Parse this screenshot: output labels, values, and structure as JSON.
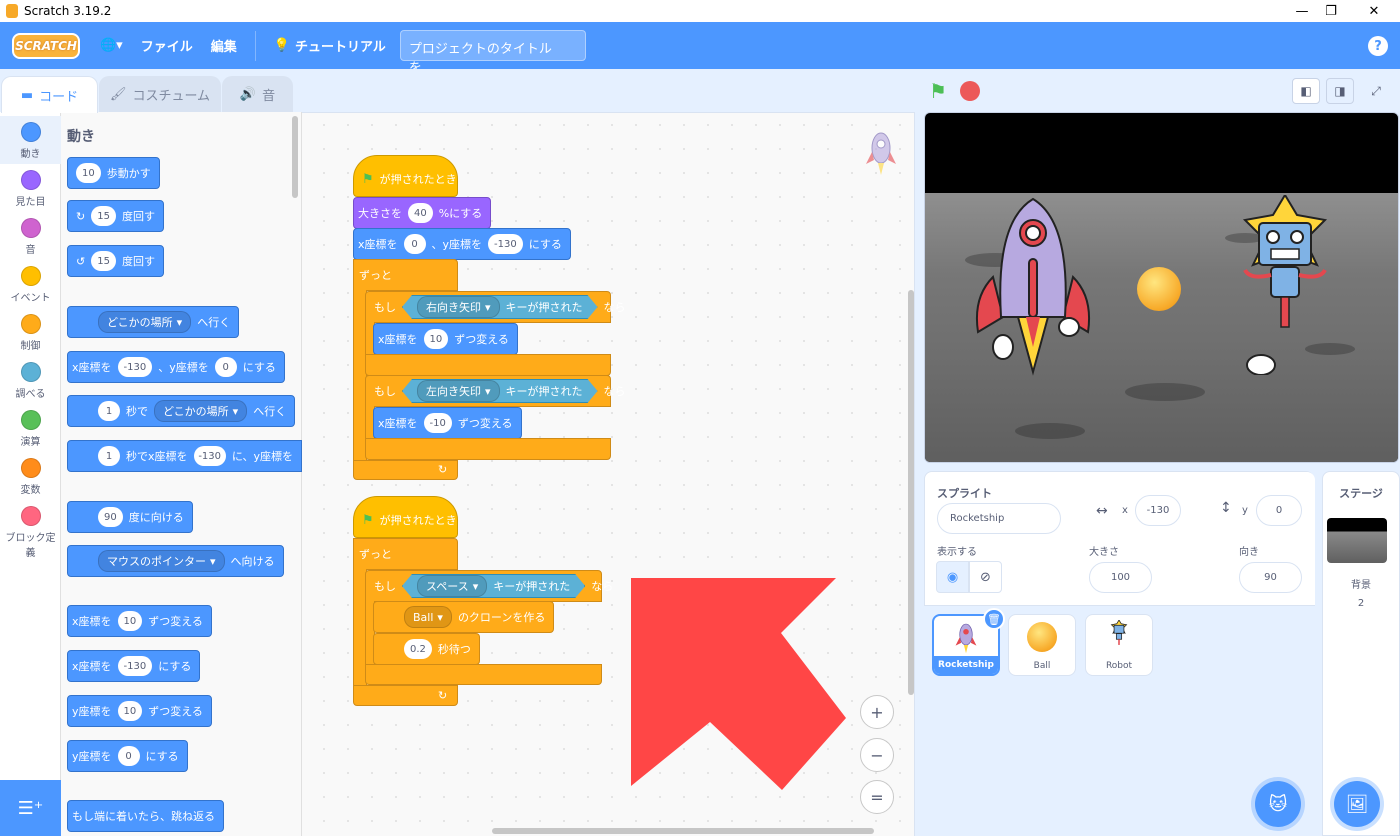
{
  "window": {
    "title": "Scratch 3.19.2",
    "minimize": "—",
    "restore": "❐",
    "close": "✕"
  },
  "menu": {
    "logo": "SCRATCH",
    "language": "🌐▾",
    "file": "ファイル",
    "edit": "編集",
    "tutorial": "チュートリアル",
    "project_title_placeholder": "プロジェクトのタイトルを...",
    "help": "?"
  },
  "tabs": {
    "code": "コード",
    "costumes": "コスチューム",
    "sounds": "音"
  },
  "categories": [
    {
      "label": "動き",
      "color": "#4c97ff"
    },
    {
      "label": "見た目",
      "color": "#9966ff"
    },
    {
      "label": "音",
      "color": "#cf63cf"
    },
    {
      "label": "イベント",
      "color": "#ffbf00"
    },
    {
      "label": "制御",
      "color": "#ffab19"
    },
    {
      "label": "調べる",
      "color": "#5cb1d6"
    },
    {
      "label": "演算",
      "color": "#59c059"
    },
    {
      "label": "変数",
      "color": "#ff8c1a"
    },
    {
      "label": "ブロック定義",
      "color": "#ff6680"
    }
  ],
  "palette": {
    "section": "動き",
    "move_steps": {
      "value": "10",
      "label": "歩動かす"
    },
    "turn_right": {
      "value": "15",
      "label": "度回す"
    },
    "turn_left": {
      "value": "15",
      "label": "度回す"
    },
    "goto": {
      "value": "どこかの場所",
      "label": "へ行く"
    },
    "goto_xy": {
      "x_label": "x座標を",
      "x": "-130",
      "y_label": "、y座標を",
      "y": "0",
      "end": "にする"
    },
    "glide": {
      "value": "1",
      "label": "秒で",
      "target": "どこかの場所",
      "end": "へ行く"
    },
    "glide_xy": {
      "value": "1",
      "label": "秒でx座標を",
      "x": "-130",
      "mid": "に、y座標を"
    },
    "point_dir": {
      "value": "90",
      "label": "度に向ける"
    },
    "point_towards": {
      "value": "マウスのポインター",
      "label": "へ向ける"
    },
    "change_x": {
      "label": "x座標を",
      "value": "10",
      "end": "ずつ変える"
    },
    "set_x": {
      "label": "x座標を",
      "value": "-130",
      "end": "にする"
    },
    "change_y": {
      "label": "y座標を",
      "value": "10",
      "end": "ずつ変える"
    },
    "set_y": {
      "label": "y座標を",
      "value": "0",
      "end": "にする"
    },
    "bounce": "もし端に着いたら、跳ね返る"
  },
  "script1": {
    "hat": "が押されたとき",
    "size": {
      "label": "大きさを",
      "value": "40",
      "end": "%にする"
    },
    "goto": {
      "label": "x座標を",
      "x": "0",
      "mid": "、y座標を",
      "y": "-130",
      "end": "にする"
    },
    "forever": "ずっと",
    "if1": {
      "if": "もし",
      "key": "右向き矢印",
      "pressed": "キーが押された",
      "then": "なら",
      "body": {
        "label": "x座標を",
        "value": "10",
        "end": "ずつ変える"
      }
    },
    "if2": {
      "if": "もし",
      "key": "左向き矢印",
      "pressed": "キーが押された",
      "then": "なら",
      "body": {
        "label": "x座標を",
        "value": "-10",
        "end": "ずつ変える"
      }
    },
    "loop_arrow": "↻"
  },
  "script2": {
    "hat": "が押されたとき",
    "forever": "ずっと",
    "if": {
      "if": "もし",
      "key": "スペース",
      "pressed": "キーが押された",
      "then": "なら"
    },
    "clone": {
      "value": "Ball",
      "label": "のクローンを作る"
    },
    "wait": {
      "value": "0.2",
      "label": "秒待つ"
    },
    "loop_arrow": "↻"
  },
  "zoom": {
    "in": "+",
    "out": "−",
    "reset": "="
  },
  "sprite_info": {
    "sprite_label": "スプライト",
    "sprite_name": "Rocketship",
    "x_label": "x",
    "x_value": "-130",
    "y_label": "y",
    "y_value": "0",
    "show_label": "表示する",
    "size_label": "大きさ",
    "size_value": "100",
    "direction_label": "向き",
    "direction_value": "90"
  },
  "sprites": [
    {
      "name": "Rocketship",
      "selected": true
    },
    {
      "name": "Ball",
      "selected": false
    },
    {
      "name": "Robot",
      "selected": false
    }
  ],
  "stage_pane": {
    "title": "ステージ",
    "backdrops_label": "背景",
    "backdrops_count": "2"
  },
  "colors": {
    "menubar": "#4c97ff",
    "motion": "#4c97ff",
    "looks": "#9966ff",
    "events": "#ffbf00",
    "control": "#ffab19",
    "sensing": "#5cb1d6",
    "arrow": "#ff4646"
  }
}
